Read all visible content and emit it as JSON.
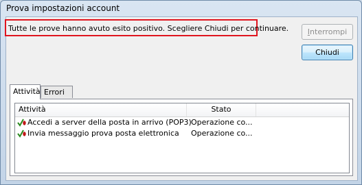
{
  "window": {
    "title": "Prova impostazioni account"
  },
  "status": {
    "message": "Tutte le prove hanno avuto esito positivo. Scegliere Chiudi per continuare."
  },
  "buttons": {
    "stop_prefix": "",
    "stop_accel": "I",
    "stop_rest": "nterrompi",
    "close_label": "Chiudi"
  },
  "tabs": [
    {
      "label": "Attività",
      "selected": true
    },
    {
      "label": "Errori",
      "selected": false
    }
  ],
  "list": {
    "columns": [
      "Attività",
      "Stato"
    ],
    "rows": [
      {
        "task": "Accedi a server della posta in arrivo (POP3)",
        "state": "Operazione co...",
        "icon": "check-success-icon"
      },
      {
        "task": "Invia messaggio prova posta elettronica",
        "state": "Operazione co...",
        "icon": "check-success-icon"
      }
    ]
  },
  "colors": {
    "highlight_border": "#e0141e",
    "check_green": "#2a8a1f",
    "dot_red": "#c01818"
  }
}
